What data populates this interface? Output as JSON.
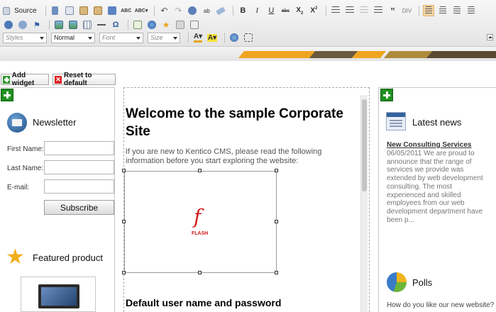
{
  "toolbar": {
    "source_label": "Source",
    "styles_placeholder": "Styles",
    "format_value": "Normal",
    "font_placeholder": "Font",
    "size_placeholder": "Size"
  },
  "widgets": {
    "add_widget_label": "Add widget",
    "reset_label": "Reset to default"
  },
  "newsletter": {
    "title": "Newsletter",
    "first_name_label": "First Name:",
    "last_name_label": "Last Name:",
    "email_label": "E-mail:",
    "subscribe_label": "Subscribe"
  },
  "featured": {
    "title": "Featured product"
  },
  "main": {
    "heading": "Welcome to the sample Corporate Site",
    "intro": "If you are new to Kentico CMS, please read the following information before you start exploring the website:",
    "flash_label": "FLASH",
    "subheading": "Default user name and password"
  },
  "news": {
    "title": "Latest news",
    "item_title": "New Consulting Services",
    "item_body": "06/05/2011 We are proud to announce that the range of services we provide was extended by web development consulting. The most experienced and skilled employees from our web development department have been p..."
  },
  "polls": {
    "title": "Polls",
    "question": "How do you like our new website?"
  },
  "colors": {
    "accent_orange": "#f0a520",
    "add_green": "#1f8f1f",
    "reset_red": "#d22222"
  }
}
